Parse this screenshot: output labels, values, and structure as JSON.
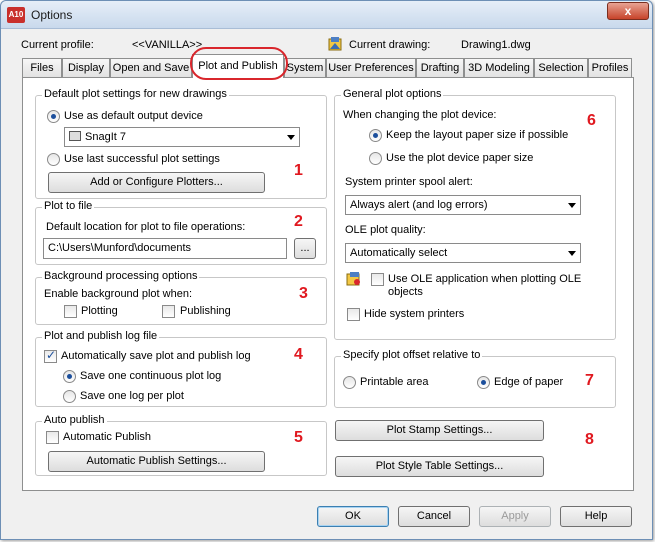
{
  "window": {
    "title": "Options",
    "app_icon_text": "A10",
    "close_symbol": "x"
  },
  "profile": {
    "current_profile_label": "Current profile:",
    "current_profile_value": "<<VANILLA>>",
    "current_drawing_label": "Current drawing:",
    "current_drawing_value": "Drawing1.dwg"
  },
  "tabs": [
    {
      "label": "Files"
    },
    {
      "label": "Display"
    },
    {
      "label": "Open and Save"
    },
    {
      "label": "Plot and Publish",
      "active": true
    },
    {
      "label": "System"
    },
    {
      "label": "User Preferences"
    },
    {
      "label": "Drafting"
    },
    {
      "label": "3D Modeling"
    },
    {
      "label": "Selection"
    },
    {
      "label": "Profiles"
    }
  ],
  "default_plot": {
    "title": "Default plot settings for new drawings",
    "use_default_label": "Use as default output device",
    "device_value": "SnagIt 7",
    "use_last_label": "Use last successful plot settings",
    "add_plotters_label": "Add or Configure Plotters...",
    "number": "1"
  },
  "plot_to_file": {
    "title": "Plot to file",
    "location_label": "Default location for plot to file operations:",
    "location_value": "C:\\Users\\Munford\\documents",
    "browse_label": "...",
    "number": "2"
  },
  "background": {
    "title": "Background processing options",
    "enable_label": "Enable background plot when:",
    "plotting_label": "Plotting",
    "publishing_label": "Publishing",
    "number": "3"
  },
  "log": {
    "title": "Plot and publish log file",
    "auto_save_label": "Automatically save plot and publish log",
    "continuous_label": "Save one continuous plot log",
    "per_plot_label": "Save one log per plot",
    "number": "4"
  },
  "auto_publish": {
    "title": "Auto publish",
    "auto_label": "Automatic Publish",
    "settings_label": "Automatic Publish Settings...",
    "number": "5"
  },
  "general": {
    "title": "General plot options",
    "when_changing_label": "When changing the plot device:",
    "keep_layout_label": "Keep the layout paper size if possible",
    "use_device_label": "Use the plot device paper size",
    "spool_label": "System printer spool alert:",
    "spool_value": "Always alert (and log errors)",
    "ole_quality_label": "OLE plot quality:",
    "ole_quality_value": "Automatically select",
    "use_ole_label_1": "Use OLE application when plotting OLE",
    "use_ole_label_2": "objects",
    "hide_printers_label": "Hide system printers",
    "number": "6"
  },
  "offset": {
    "title": "Specify plot offset relative to",
    "printable_label": "Printable area",
    "edge_label": "Edge of paper",
    "number": "7"
  },
  "stamp": {
    "plot_stamp_label": "Plot Stamp Settings...",
    "style_table_label": "Plot Style Table Settings...",
    "number": "8"
  },
  "footer": {
    "ok_label": "OK",
    "cancel_label": "Cancel",
    "apply_label": "Apply",
    "help_label": "Help"
  },
  "colors": {
    "annotation_red": "#e0181f",
    "accent_blue": "#1c4f9c"
  }
}
